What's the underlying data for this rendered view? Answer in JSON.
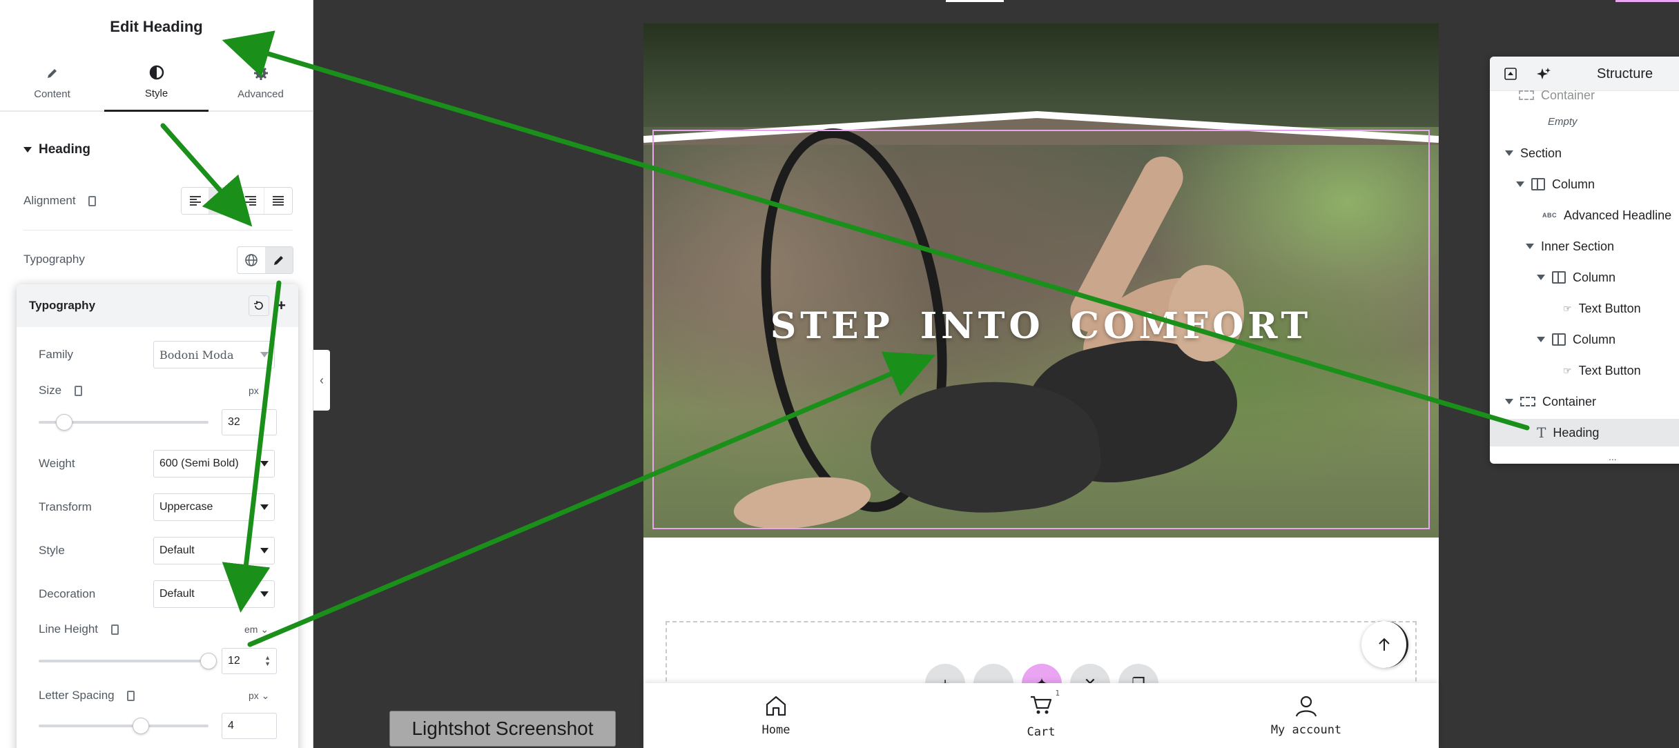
{
  "panel": {
    "title": "Edit Heading",
    "tabs": [
      {
        "label": "Content",
        "icon": "pencil-icon"
      },
      {
        "label": "Style",
        "icon": "contrast-icon",
        "active": true
      },
      {
        "label": "Advanced",
        "icon": "gear-icon"
      }
    ],
    "section_title": "Heading",
    "alignment_label": "Alignment",
    "alignment_options": [
      "left",
      "center",
      "right",
      "justify"
    ],
    "alignment_selected": "center",
    "typography_label": "Typography",
    "typography_popover": {
      "title": "Typography",
      "family_label": "Family",
      "family_value": "Bodoni Moda",
      "size_label": "Size",
      "size_unit": "px",
      "size_value": "32",
      "size_slider_fraction": 0.15,
      "weight_label": "Weight",
      "weight_value": "600 (Semi Bold)",
      "transform_label": "Transform",
      "transform_value": "Uppercase",
      "style_label": "Style",
      "style_value": "Default",
      "decoration_label": "Decoration",
      "decoration_value": "Default",
      "line_height_label": "Line Height",
      "line_height_unit": "em",
      "line_height_value": "12",
      "line_height_slider_fraction": 1.0,
      "letter_spacing_label": "Letter Spacing",
      "letter_spacing_unit": "px",
      "letter_spacing_value": "4",
      "letter_spacing_slider_fraction": 0.6
    }
  },
  "canvas": {
    "hero_heading": "STEP INTO COMFORT",
    "outline_color": "#e7a7f0",
    "fab_icons": [
      "plus-icon",
      "folder-icon",
      "ai-sparkle-icon",
      "x-icon",
      "copy-icon"
    ],
    "bottom_nav": [
      {
        "label": "Home",
        "icon": "home-icon"
      },
      {
        "label": "Cart",
        "icon": "cart-icon",
        "badge": "1"
      },
      {
        "label": "My account",
        "icon": "user-icon"
      }
    ]
  },
  "structure": {
    "title": "Structure",
    "items": [
      {
        "label": "Container",
        "type": "container"
      },
      {
        "label": "Empty",
        "type": "empty"
      },
      {
        "label": "Section",
        "type": "section"
      },
      {
        "label": "Column",
        "type": "column"
      },
      {
        "label": "Advanced Headline",
        "type": "widget"
      },
      {
        "label": "Inner Section",
        "type": "section"
      },
      {
        "label": "Column",
        "type": "column"
      },
      {
        "label": "Text Button",
        "type": "widget"
      },
      {
        "label": "Column",
        "type": "column"
      },
      {
        "label": "Text Button",
        "type": "widget"
      },
      {
        "label": "Container",
        "type": "container"
      },
      {
        "label": "Heading",
        "type": "heading",
        "selected": true
      }
    ],
    "more": "..."
  },
  "overlay": {
    "lightshot_label": "Lightshot Screenshot",
    "arrow_color": "#1a8f1a"
  },
  "colors": {
    "background": "#353535",
    "accent": "#1f2124",
    "selection_pink": "#e9a4f2"
  }
}
